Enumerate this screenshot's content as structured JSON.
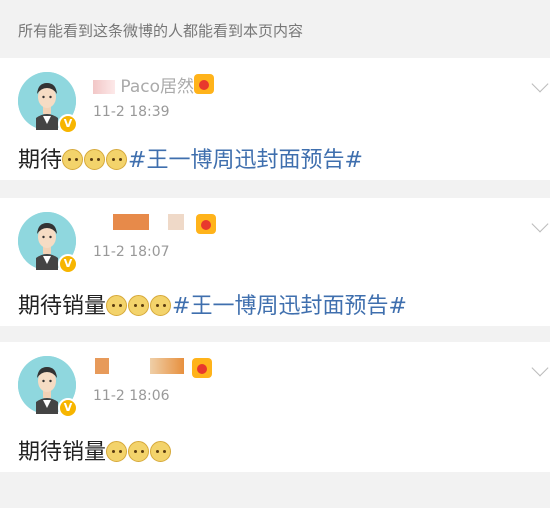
{
  "notice": "所有能看到这条微博的人都能看到本页内容",
  "posts": [
    {
      "name_visible": "Paco居然",
      "time": "11-2 18:39",
      "text": "期待",
      "emoji_count": 3,
      "hashtag": "#王一博周迅封面预告#"
    },
    {
      "name_visible": "",
      "time": "11-2 18:07",
      "text": "期待销量",
      "emoji_count": 3,
      "hashtag": "#王一博周迅封面预告#"
    },
    {
      "name_visible": "",
      "time": "11-2 18:06",
      "text": "期待销量",
      "emoji_count": 3,
      "hashtag": ""
    }
  ],
  "icons": {
    "avatar": "avatar-icon",
    "verified": "verified-badge-icon",
    "level": "level-badge-icon",
    "more": "chevron-down-icon",
    "emoji": "doge-emoji-icon"
  },
  "colors": {
    "hashtag": "#3f6fae",
    "verified": "#f7b500",
    "avatar_bg": "#8fd7de"
  }
}
